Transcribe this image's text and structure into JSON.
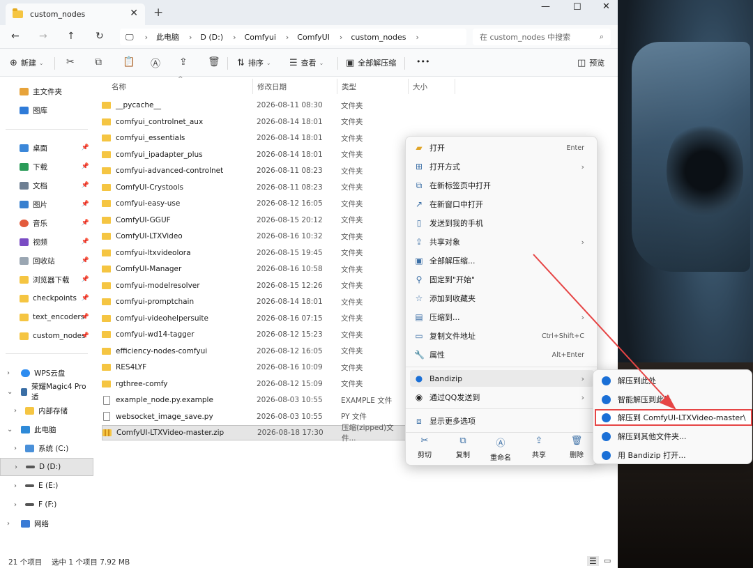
{
  "window": {
    "tab_title": "custom_nodes",
    "tab_close": "✕",
    "tab_add": "+",
    "minimize": "—",
    "maximize": "☐",
    "close": "✕"
  },
  "address": {
    "crumbs": [
      "此电脑",
      "D (D:)",
      "Comfyui",
      "ComfyUI",
      "custom_nodes"
    ],
    "search_placeholder": "在 custom_nodes 中搜索"
  },
  "toolbar": {
    "new_label": "新建",
    "sort_label": "排序",
    "view_label": "查看",
    "extract_all_label": "全部解压缩",
    "more_label": "•••",
    "preview_label": "预览"
  },
  "sidebar": {
    "top": [
      {
        "label": "主文件夹"
      },
      {
        "label": "图库"
      }
    ],
    "quick": [
      {
        "label": "桌面"
      },
      {
        "label": "下载"
      },
      {
        "label": "文档"
      },
      {
        "label": "图片"
      },
      {
        "label": "音乐"
      },
      {
        "label": "视频"
      },
      {
        "label": "回收站"
      },
      {
        "label": "浏览器下载"
      },
      {
        "label": "checkpoints"
      },
      {
        "label": "text_encoders"
      },
      {
        "label": "custom_nodes"
      }
    ],
    "tree": [
      {
        "label": "WPS云盘"
      },
      {
        "label": "荣耀Magic4 Pro适"
      },
      {
        "label": "内部存储"
      },
      {
        "label": "此电脑"
      },
      {
        "label": "系统 (C:)"
      },
      {
        "label": "D (D:)"
      },
      {
        "label": "E (E:)"
      },
      {
        "label": "F (F:)"
      },
      {
        "label": "网络"
      }
    ]
  },
  "columns": {
    "name": "名称",
    "date": "修改日期",
    "type": "类型",
    "size": "大小"
  },
  "files": [
    {
      "name": "__pycache__",
      "date": "2026-08-11 08:30",
      "type": "文件夹"
    },
    {
      "name": "comfyui_controlnet_aux",
      "date": "2026-08-14 18:01",
      "type": "文件夹"
    },
    {
      "name": "comfyui_essentials",
      "date": "2026-08-14 18:01",
      "type": "文件夹"
    },
    {
      "name": "comfyui_ipadapter_plus",
      "date": "2026-08-14 18:01",
      "type": "文件夹"
    },
    {
      "name": "comfyui-advanced-controlnet",
      "date": "2026-08-11 08:23",
      "type": "文件夹"
    },
    {
      "name": "ComfyUI-Crystools",
      "date": "2026-08-11 08:23",
      "type": "文件夹"
    },
    {
      "name": "comfyui-easy-use",
      "date": "2026-08-12 16:05",
      "type": "文件夹"
    },
    {
      "name": "ComfyUI-GGUF",
      "date": "2026-08-15 20:12",
      "type": "文件夹"
    },
    {
      "name": "ComfyUI-LTXVideo",
      "date": "2026-08-16 10:32",
      "type": "文件夹"
    },
    {
      "name": "comfyui-ltxvideolora",
      "date": "2026-08-15 19:45",
      "type": "文件夹"
    },
    {
      "name": "ComfyUI-Manager",
      "date": "2026-08-16 10:58",
      "type": "文件夹"
    },
    {
      "name": "comfyui-modelresolver",
      "date": "2026-08-15 12:26",
      "type": "文件夹"
    },
    {
      "name": "comfyui-promptchain",
      "date": "2026-08-14 18:01",
      "type": "文件夹"
    },
    {
      "name": "comfyui-videohelpersuite",
      "date": "2026-08-16 07:15",
      "type": "文件夹"
    },
    {
      "name": "comfyui-wd14-tagger",
      "date": "2026-08-12 15:23",
      "type": "文件夹"
    },
    {
      "name": "efficiency-nodes-comfyui",
      "date": "2026-08-12 16:05",
      "type": "文件夹"
    },
    {
      "name": "RES4LYF",
      "date": "2026-08-16 10:09",
      "type": "文件夹"
    },
    {
      "name": "rgthree-comfy",
      "date": "2026-08-12 15:09",
      "type": "文件夹"
    },
    {
      "name": "example_node.py.example",
      "date": "2026-08-03 10:55",
      "type": "EXAMPLE 文件"
    },
    {
      "name": "websocket_image_save.py",
      "date": "2026-08-03 10:55",
      "type": "PY 文件"
    },
    {
      "name": "ComfyUI-LTXVideo-master.zip",
      "date": "2026-08-18 17:30",
      "type": "压缩(zipped)文件..."
    }
  ],
  "status": {
    "count": "21 个项目",
    "selected": "选中 1 个项目  7.92 MB"
  },
  "context_menu": {
    "items": [
      {
        "label": "打开",
        "shortcut": "Enter"
      },
      {
        "label": "打开方式"
      },
      {
        "label": "在新标签页中打开"
      },
      {
        "label": "在新窗口中打开"
      },
      {
        "label": "发送到我的手机"
      },
      {
        "label": "共享对象"
      },
      {
        "label": "全部解压缩..."
      },
      {
        "label": "固定到\"开始\""
      },
      {
        "label": "添加到收藏夹"
      },
      {
        "label": "压缩到..."
      },
      {
        "label": "复制文件地址",
        "shortcut": "Ctrl+Shift+C"
      },
      {
        "label": "属性",
        "shortcut": "Alt+Enter"
      },
      {
        "label": "Bandizip"
      },
      {
        "label": "通过QQ发送到"
      },
      {
        "label": "显示更多选项"
      }
    ],
    "bottom": [
      {
        "label": "剪切"
      },
      {
        "label": "复制"
      },
      {
        "label": "重命名"
      },
      {
        "label": "共享"
      },
      {
        "label": "删除"
      }
    ]
  },
  "submenu": {
    "items": [
      {
        "label": "解压到此处"
      },
      {
        "label": "智能解压到此处"
      },
      {
        "label": "解压到 ComfyUI-LTXVideo-master\\"
      },
      {
        "label": "解压到其他文件夹..."
      },
      {
        "label": "用 Bandizip 打开..."
      }
    ]
  },
  "colors": {
    "accent": "#1a6fd6",
    "folder": "#f5c542",
    "highlight_border": "#e64545",
    "arrow": "#e64545"
  }
}
